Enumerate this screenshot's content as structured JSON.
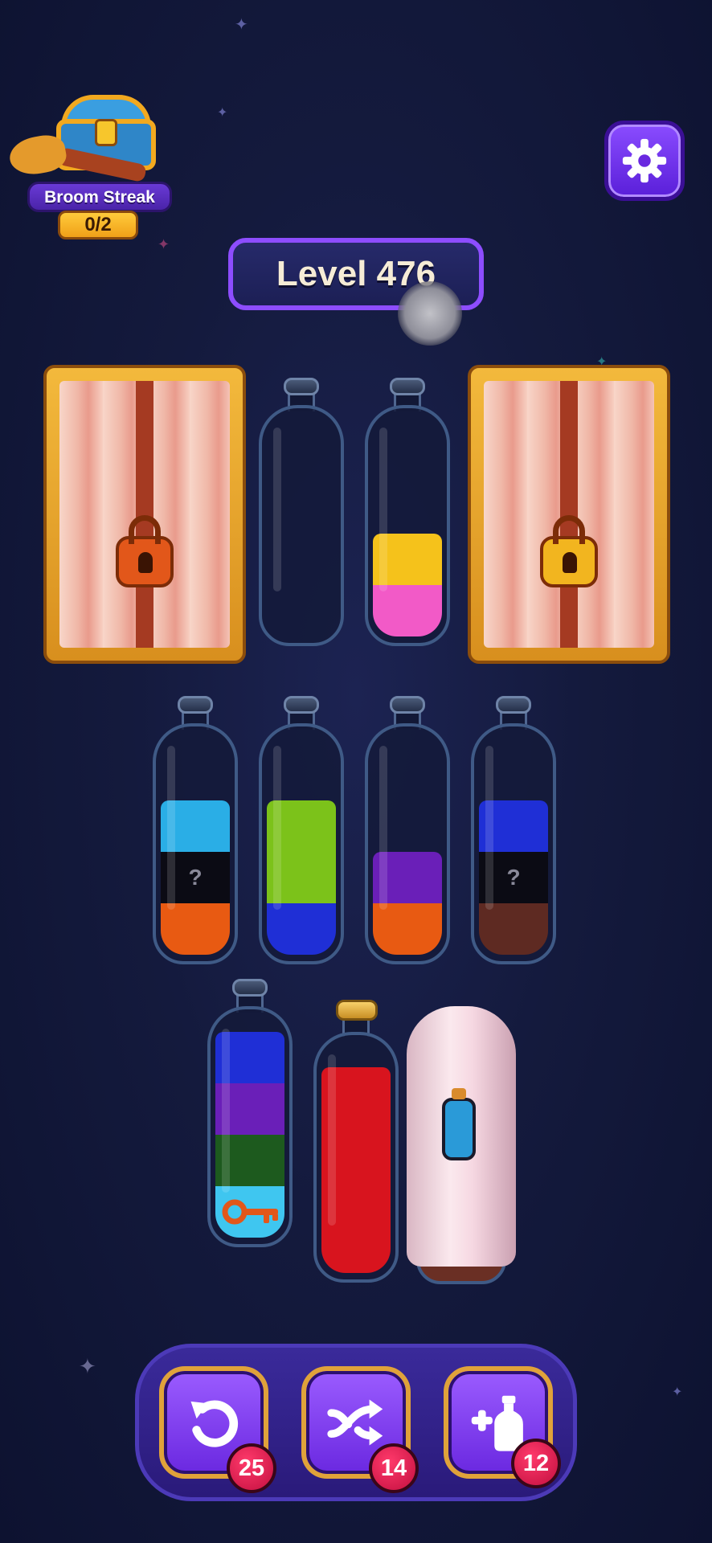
{
  "broom_streak": {
    "label": "Broom Streak",
    "count": "0/2"
  },
  "level": {
    "label": "Level 476"
  },
  "icons": {
    "settings": "gear-icon",
    "undo": "undo-icon",
    "shuffle": "shuffle-icon",
    "add_bottle": "add-bottle-icon"
  },
  "colors": {
    "yellow": "#f5c21b",
    "pink": "#f25ac7",
    "sky": "#2aaee6",
    "black": "#0b0b14",
    "orange": "#e85a12",
    "lime": "#7cc21a",
    "blue": "#1f2fd6",
    "purple": "#6a1fb8",
    "brown": "#5e2a22",
    "green": "#1d5a1e",
    "light_blue": "#3fc6f0",
    "red": "#d8141e"
  },
  "rows": {
    "row1": {
      "locked_left": {
        "lock_color": "#e2571a"
      },
      "bottle_empty": {
        "layers": []
      },
      "bottle_yp": {
        "layers": [
          "pink",
          "yellow"
        ]
      },
      "locked_right": {
        "lock_color": "#f2b51f"
      }
    },
    "row2": [
      {
        "layers": [
          "orange",
          "black",
          "sky"
        ],
        "hidden": [
          "?"
        ]
      },
      {
        "layers": [
          "blue",
          "lime",
          "lime"
        ]
      },
      {
        "layers": [
          "orange",
          "purple"
        ]
      },
      {
        "layers": [
          "brown",
          "black",
          "blue"
        ],
        "hidden": [
          "?"
        ]
      }
    ],
    "row3": {
      "key_bottle": {
        "layers": [
          "light_blue",
          "green",
          "purple",
          "blue"
        ],
        "has_key": true
      },
      "corked_bottle": {
        "layers": [
          "red",
          "red",
          "red",
          "red"
        ],
        "corked": true
      },
      "covered_bottle": {
        "covered": true
      }
    }
  },
  "toolbar": {
    "undo_count": "25",
    "shuffle_count": "14",
    "add_bottle_count": "12"
  }
}
